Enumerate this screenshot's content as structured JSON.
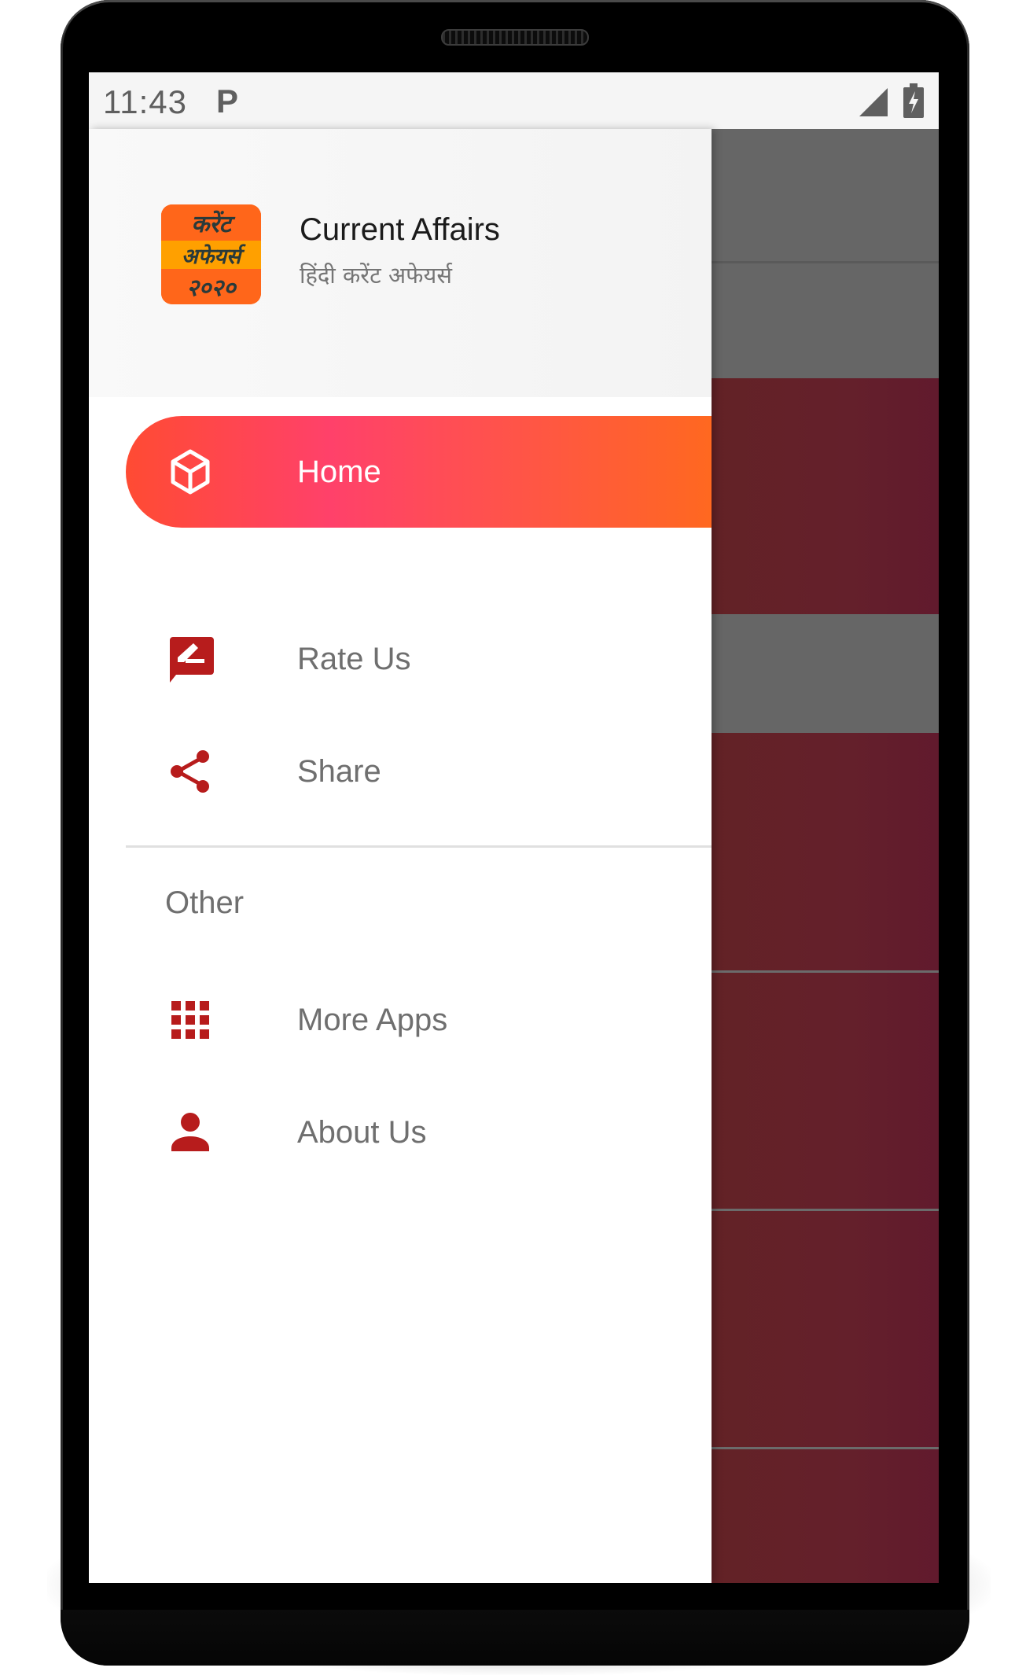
{
  "status_bar": {
    "time": "11:43",
    "notification_icon": "parking-p-icon",
    "signal_icon": "cellular-signal-icon",
    "battery_icon": "battery-charging-icon"
  },
  "drawer": {
    "header": {
      "logo": {
        "line1": "करेंट",
        "line2": "अफेयर्स",
        "line3": "२०२०"
      },
      "title": "Current Affairs",
      "subtitle": "हिंदी करेंट अफेयर्स"
    },
    "main_items": [
      {
        "label": "Home",
        "icon": "cube-icon",
        "active": true
      },
      {
        "label": "Rate Us",
        "icon": "rate-review-icon",
        "active": false
      },
      {
        "label": "Share",
        "icon": "share-icon",
        "active": false
      }
    ],
    "section_title": "Other",
    "other_items": [
      {
        "label": "More Apps",
        "icon": "apps-grid-icon"
      },
      {
        "label": "About Us",
        "icon": "person-icon"
      }
    ]
  },
  "colors": {
    "accent_gradient_start": "#ff4b33",
    "accent_gradient_mid": "#ff416a",
    "accent_gradient_end": "#ff6820",
    "icon_red": "#b71c1c",
    "text_gray": "#6f6f6f",
    "background_list_red": "#632226",
    "background_list_gray": "#666666"
  },
  "background_list": {
    "chevron_icon": "chevron-right-icon",
    "rows": 5
  }
}
